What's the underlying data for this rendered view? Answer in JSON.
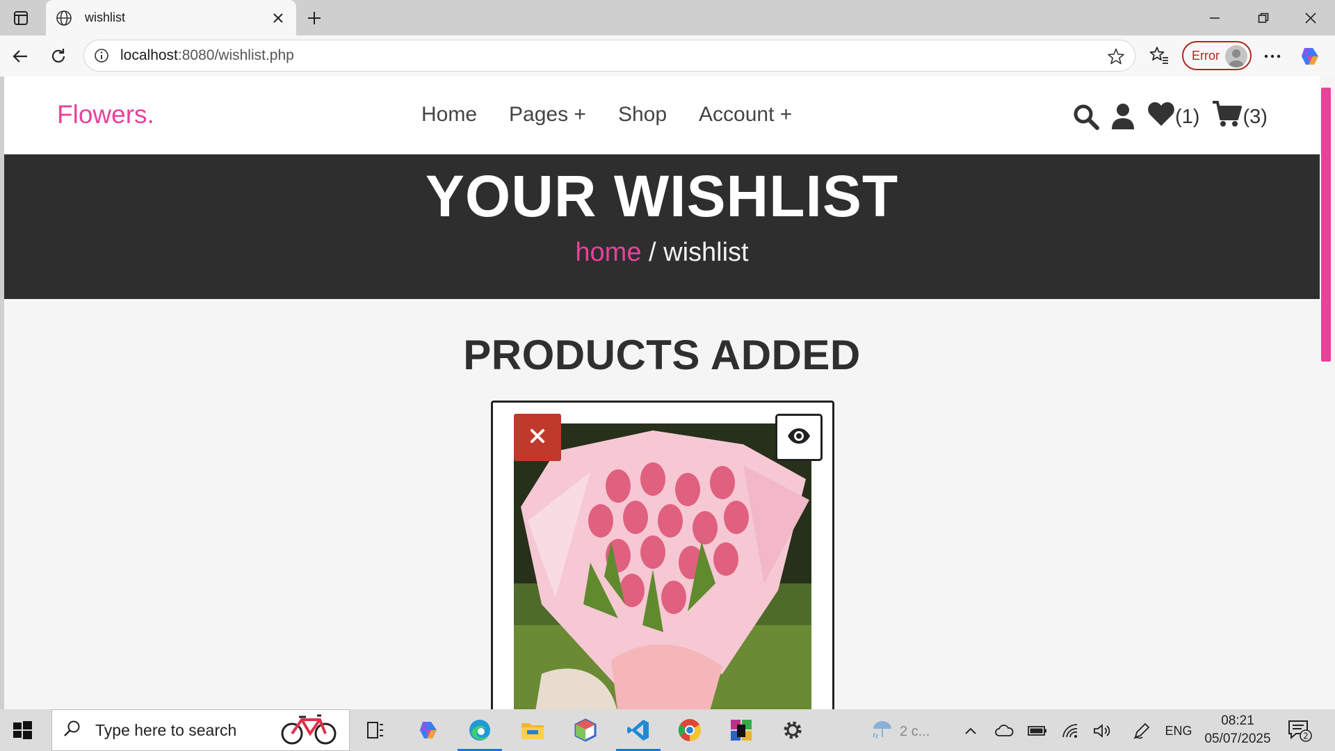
{
  "browser": {
    "tab_title": "wishlist",
    "url_host": "localhost",
    "url_rest": ":8080/wishlist.php",
    "profile_status": "Error"
  },
  "site": {
    "logo": "Flowers.",
    "nav": [
      "Home",
      "Pages +",
      "Shop",
      "Account +"
    ],
    "wishlist_count": "(1)",
    "cart_count": "(3)",
    "accent_color": "#e8429b"
  },
  "hero": {
    "title": "YOUR WISHLIST",
    "breadcrumb_home": "home",
    "breadcrumb_sep": " / ",
    "breadcrumb_current": "wishlist"
  },
  "main": {
    "section_title": "PRODUCTS ADDED"
  },
  "taskbar": {
    "search_placeholder": "Type here to search",
    "weather": "2 c...",
    "language": "ENG",
    "time": "08:21",
    "date": "05/07/2025",
    "notification_count": "2"
  }
}
